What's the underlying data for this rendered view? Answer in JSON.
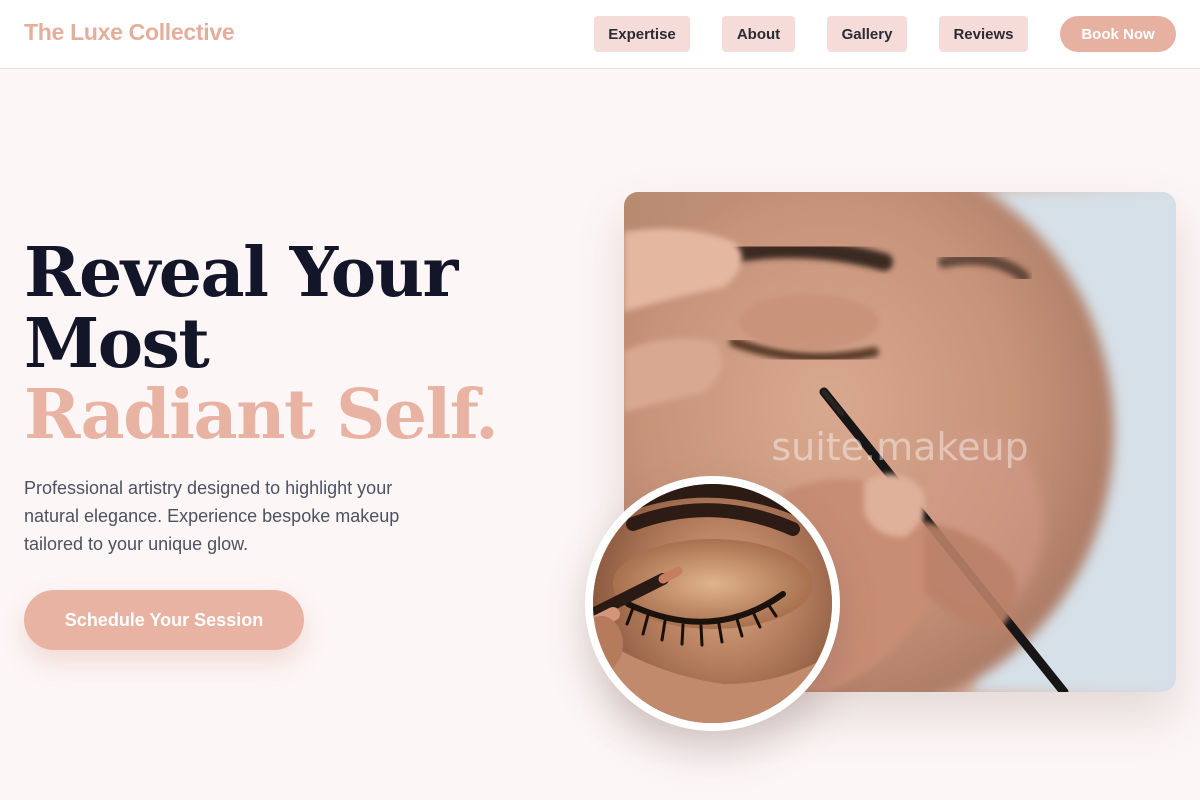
{
  "header": {
    "brand": "The Luxe Collective",
    "nav": [
      {
        "label": "Expertise"
      },
      {
        "label": "About"
      },
      {
        "label": "Gallery"
      },
      {
        "label": "Reviews"
      }
    ],
    "book_label": "Book Now"
  },
  "hero": {
    "headline_line1": "Reveal Your",
    "headline_line2": "Most",
    "headline_line3": "Radiant Self.",
    "subtext": "Professional artistry designed to highlight your natural elegance. Experience bespoke makeup tailored to your unique glow.",
    "cta_label": "Schedule Your Session",
    "watermark": "suite.makeup"
  },
  "colors": {
    "accent": "#e6b1a0",
    "nav_bg": "#f6dcd9",
    "page_bg": "#fcf6f6",
    "heading": "#131528"
  }
}
